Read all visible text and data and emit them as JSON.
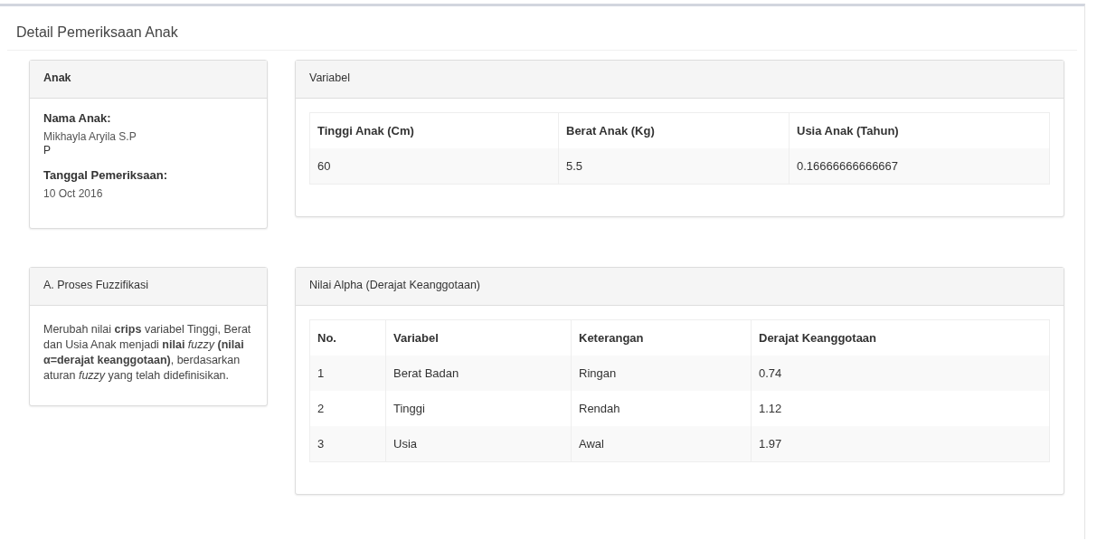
{
  "page": {
    "title": "Detail Pemeriksaan Anak"
  },
  "child_panel": {
    "heading": "Anak",
    "fields": [
      {
        "label": "Nama Anak:",
        "values": [
          "Mikhayla Aryila S.P",
          "P"
        ]
      },
      {
        "label": "Tanggal Pemeriksaan:",
        "values": [
          "10 Oct 2016"
        ]
      }
    ]
  },
  "variable_panel": {
    "heading": "Variabel",
    "table": {
      "columns": [
        "Tinggi Anak (Cm)",
        "Berat Anak (Kg)",
        "Usia Anak (Tahun)"
      ],
      "rows": [
        [
          "60",
          "5.5",
          "0.16666666666667"
        ]
      ]
    }
  },
  "fuzzification_panel": {
    "heading": "A. Proses Fuzzifikasi",
    "text": "Merubah nilai **crips** variabel Tinggi, Berat dan Usia Anak menjadi **nilai** *fuzzy* **(nilai α=derajat keanggotaan)**, berdasarkan aturan *fuzzy* yang telah didefinisikan."
  },
  "alpha_panel": {
    "heading": "Nilai Alpha (Derajat Keanggotaan)",
    "table": {
      "columns": [
        "No.",
        "Variabel",
        "Keterangan",
        "Derajat Keanggotaan"
      ],
      "rows": [
        [
          "1",
          "Berat Badan",
          "Ringan",
          "0.74"
        ],
        [
          "2",
          "Tinggi",
          "Rendah",
          "1.12"
        ],
        [
          "3",
          "Usia",
          "Awal",
          "1.97"
        ]
      ]
    }
  }
}
